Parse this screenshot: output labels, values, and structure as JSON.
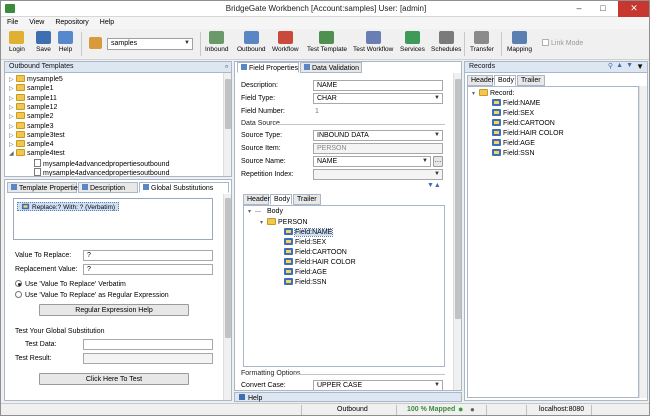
{
  "window": {
    "title": "BridgeGate Workbench [Account:samples] User: [admin]"
  },
  "menu": [
    "File",
    "View",
    "Repository",
    "Help"
  ],
  "toolbar": {
    "login": "Login",
    "save": "Save",
    "help": "Help",
    "account_combo": "samples",
    "inbound": "Inbound",
    "outbound": "Outbound",
    "workflow": "Workflow",
    "test_template": "Test Template",
    "test_workflow": "Test Workflow",
    "services": "Services",
    "schedules": "Schedules",
    "transfer": "Transfer",
    "mapping": "Mapping",
    "link_mode": "Link Mode"
  },
  "outbound_templates": {
    "title": "Outbound Templates",
    "items": [
      {
        "label": "mysample5",
        "type": "folder"
      },
      {
        "label": "sample1",
        "type": "folder"
      },
      {
        "label": "sample11",
        "type": "folder"
      },
      {
        "label": "sample12",
        "type": "folder"
      },
      {
        "label": "sample2",
        "type": "folder"
      },
      {
        "label": "sample3",
        "type": "folder"
      },
      {
        "label": "sample3test",
        "type": "folder"
      },
      {
        "label": "sample4",
        "type": "folder"
      },
      {
        "label": "sample4test",
        "type": "folder-open"
      },
      {
        "label": "mysample4advancedpropertiesoutbound",
        "type": "doc"
      },
      {
        "label": "mysample4advancedpropertiesoutbound",
        "type": "doc"
      }
    ]
  },
  "left_tabs": [
    "Template Properties",
    "Description",
    "Global Substitutions"
  ],
  "substitution_item": "Replace:? With: ? (Verbatim)",
  "value_to_replace_label": "Value To Replace:",
  "value_to_replace": "?",
  "replacement_value_label": "Replacement Value:",
  "replacement_value": "?",
  "radio_verbatim": "Use 'Value To Replace' Verbatim",
  "radio_regex": "Use 'Value To Replace' as Regular Expression",
  "regex_help_button": "Regular Expression Help",
  "test_section": "Test Your Global Substitution",
  "test_data_label": "Test Data:",
  "test_result_label": "Test Result:",
  "test_button": "Click Here To Test",
  "middle_tabs": [
    "Field Properties",
    "Data Validation"
  ],
  "field_props": {
    "description_label": "Description:",
    "description": "NAME",
    "field_type_label": "Field Type:",
    "field_type": "CHAR",
    "field_number_label": "Field Number:",
    "field_number": "1",
    "data_source_section": "Data Source",
    "source_type_label": "Source Type:",
    "source_type": "INBOUND DATA",
    "source_item_label": "Source Item:",
    "source_item": "PERSON",
    "source_name_label": "Source Name:",
    "source_name": "NAME",
    "repetition_label": "Repetition Index:",
    "formatting_section": "Formatting Options",
    "convert_case_label": "Convert Case:",
    "convert_case": "UPPER CASE"
  },
  "inner_tabs": [
    "Header",
    "Body",
    "Trailer"
  ],
  "inner_tree": {
    "root": "Body",
    "group": "PERSON",
    "fields": [
      "Field:NAME",
      "Field:SEX",
      "Field:CARTOON",
      "Field:HAIR COLOR",
      "Field:AGE",
      "Field:SSN"
    ]
  },
  "records": {
    "title": "Records",
    "tabs": [
      "Header",
      "Body",
      "Trailer"
    ],
    "root": "Record:",
    "fields": [
      "Field:NAME",
      "Field:SEX",
      "Field:CARTOON",
      "Field:HAIR COLOR",
      "Field:AGE",
      "Field:SSN"
    ]
  },
  "help_bar": "Help",
  "status": {
    "mode": "Outbound",
    "mapped": "100 % Mapped",
    "server": "localhost:8080"
  }
}
